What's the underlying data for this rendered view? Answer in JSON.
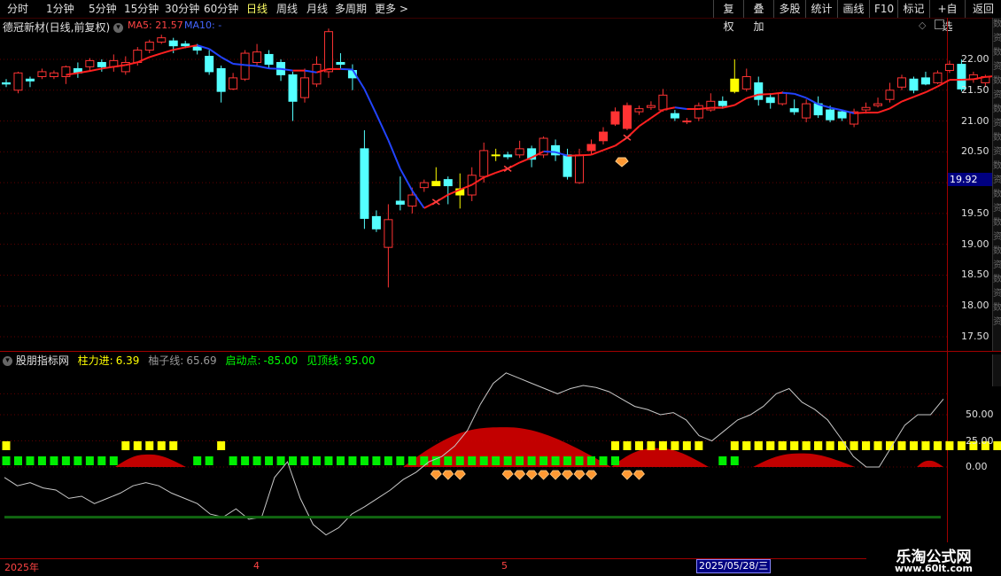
{
  "toolbar": {
    "left_items": [
      "分时",
      "1分钟",
      "5分钟",
      "15分钟",
      "30分钟",
      "60分钟",
      "日线",
      "周线",
      "月线",
      "多周期",
      "更多 >"
    ],
    "active_index": 6,
    "right_items": [
      "复权",
      "叠加",
      "多股",
      "统计",
      "画线",
      "F10",
      "标记",
      "+自选",
      "返回"
    ]
  },
  "chart": {
    "stock_title": "德冠新材(日线,前复权)",
    "ma5_label": "MA5: 21.57",
    "ma10_label": "MA10: -",
    "price_ticks": [
      "22.00",
      "21.50",
      "21.00",
      "20.50",
      "20.00",
      "19.50",
      "19.00",
      "18.50",
      "18.00",
      "17.50"
    ],
    "current_price": "19.92"
  },
  "indicator": {
    "name": "股朋指标网",
    "zhuli_label": "柱力进:",
    "zhuli_value": "6.39",
    "youzi_label": "柚子线:",
    "youzi_value": "65.69",
    "qidong_label": "启动点:",
    "qidong_value": "-85.00",
    "jianding_label": "见顶线:",
    "jianding_value": "95.00",
    "ticks": [
      "50.00",
      "25.00",
      "0.00"
    ]
  },
  "date_axis": {
    "labels": [
      "2025年",
      "4",
      "5"
    ],
    "selected_date": "2025/05/28/三"
  },
  "watermark": {
    "name": "乐淘公式网",
    "url": "www.60lt.com"
  },
  "colors": {
    "up": "#ff3333",
    "down": "#54ffff",
    "ma5": "#ff2020",
    "ma10": "#2244ff",
    "yellow": "#ffff00",
    "green": "#00ee00",
    "area": "#cc0000"
  }
}
